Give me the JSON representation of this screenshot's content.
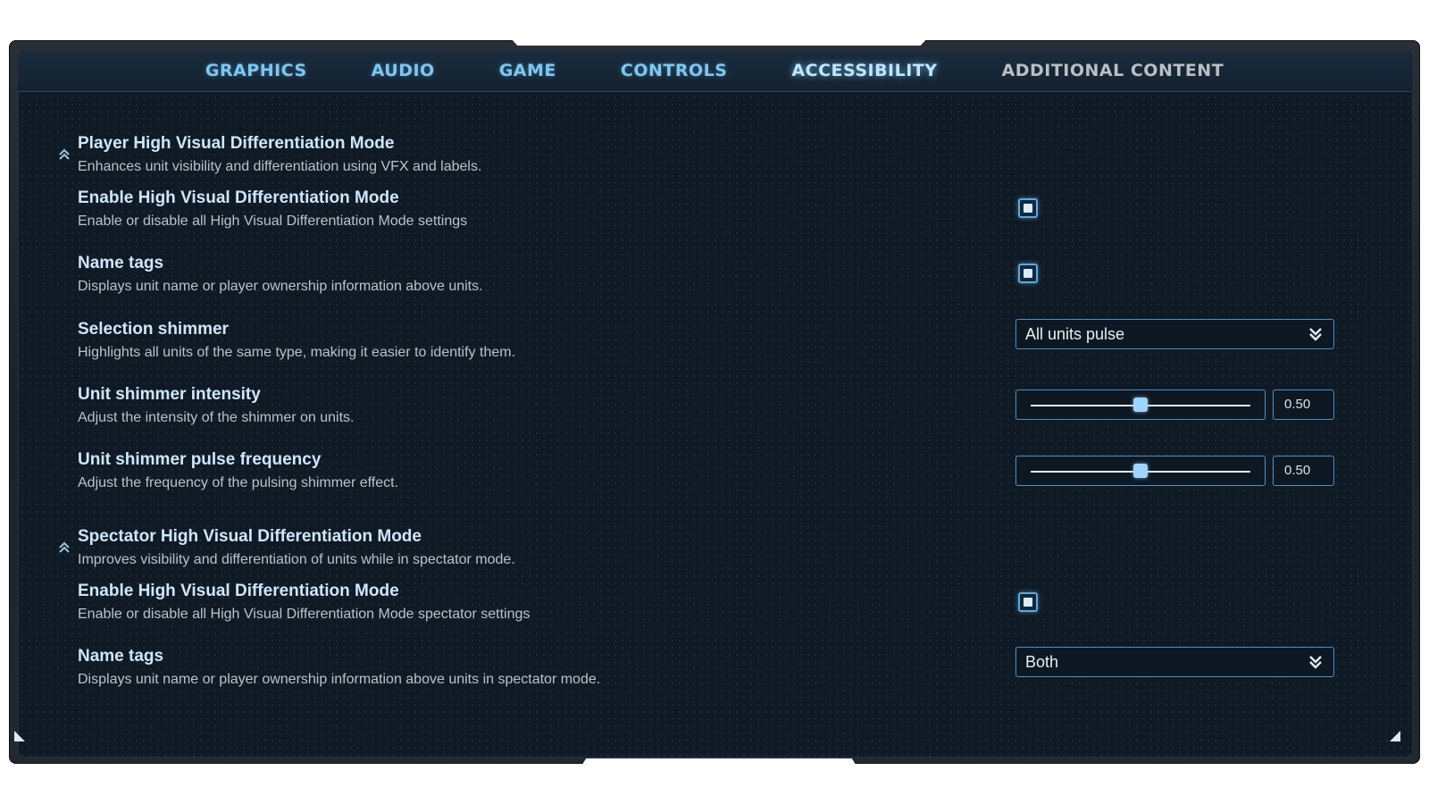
{
  "tabs": [
    {
      "label": "GRAPHICS"
    },
    {
      "label": "AUDIO"
    },
    {
      "label": "GAME"
    },
    {
      "label": "CONTROLS"
    },
    {
      "label": "ACCESSIBILITY"
    },
    {
      "label": "ADDITIONAL CONTENT"
    }
  ],
  "active_tab": "ACCESSIBILITY",
  "player_section": {
    "title": "Player High Visual Differentiation Mode",
    "desc": "Enhances unit visibility and differentiation using VFX and labels.",
    "expanded": true,
    "enable": {
      "title": "Enable High Visual Differentiation Mode",
      "desc": "Enable or disable all High Visual Differentiation Mode settings",
      "checked": true
    },
    "name_tags": {
      "title": "Name tags",
      "desc": "Displays unit name or player ownership information above units.",
      "checked": true
    },
    "selection_shimmer": {
      "title": "Selection shimmer",
      "desc": "Highlights all units of the same type, making it easier to identify them.",
      "value": "All units pulse"
    },
    "shimmer_intensity": {
      "title": "Unit shimmer intensity",
      "desc": "Adjust the intensity of the shimmer on units.",
      "value": 0.5,
      "display": "0.50"
    },
    "shimmer_frequency": {
      "title": "Unit shimmer pulse frequency",
      "desc": "Adjust the frequency of the pulsing shimmer effect.",
      "value": 0.5,
      "display": "0.50"
    }
  },
  "spectator_section": {
    "title": "Spectator High Visual Differentiation Mode",
    "desc": "Improves visibility and differentiation of units while in spectator mode.",
    "expanded": true,
    "enable": {
      "title": "Enable High Visual Differentiation Mode",
      "desc": "Enable or disable all High Visual Differentiation Mode spectator settings",
      "checked": true
    },
    "name_tags": {
      "title": "Name tags",
      "desc": "Displays unit name or player ownership information above units in spectator mode.",
      "value": "Both"
    }
  },
  "colors": {
    "accent": "#5fa8de",
    "panel_bg": "#0f1a25",
    "tab_text": "#7fc7f0",
    "tab_text_muted": "#b9bfc5"
  },
  "icons": {
    "collapse": "chevron-double-up-icon",
    "dropdown": "chevron-double-down-icon"
  }
}
